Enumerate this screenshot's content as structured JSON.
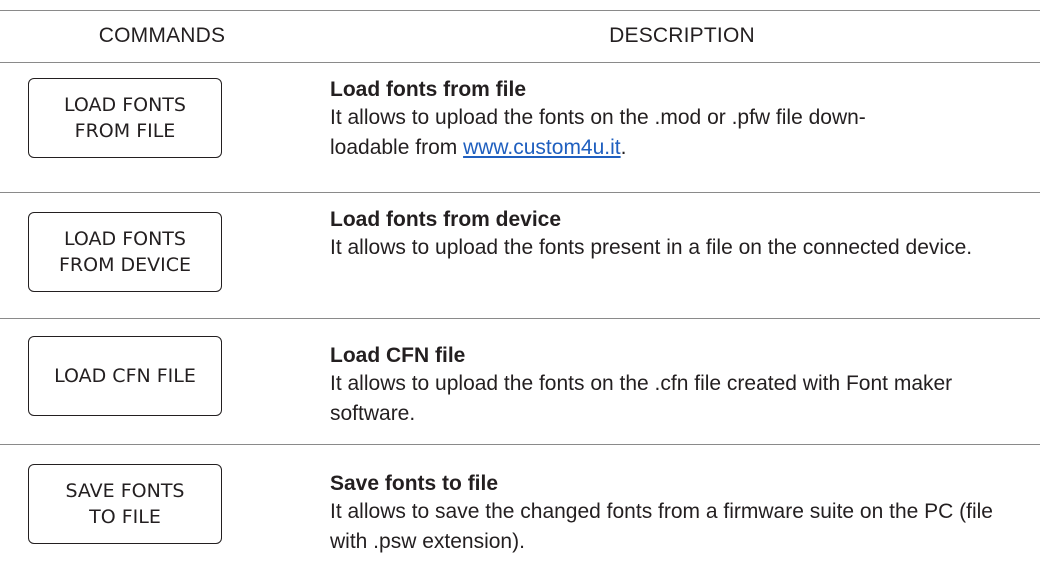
{
  "header": {
    "commands": "COMMANDS",
    "description": "DESCRIPTION"
  },
  "rows": [
    {
      "button": "LOAD FONTS\nFROM FILE",
      "title": "Load fonts from file",
      "text_line1": "It allows to upload the fonts on the .mod or .pfw file down-",
      "text_line2_before": "loadable from ",
      "link": "www.custom4u.it",
      "text_line2_after": "."
    },
    {
      "button": "LOAD FONTS\nFROM DEVICE",
      "title": "Load fonts from device",
      "text": "It allows to upload the fonts present in a file on the connected device."
    },
    {
      "button": "LOAD CFN FILE",
      "title": "Load CFN file",
      "text": "It allows to upload the fonts on the .cfn file created with Font maker software."
    },
    {
      "button": "SAVE FONTS\nTO FILE",
      "title": "Save fonts to file",
      "text": "It allows to save the changed fonts from a firmware suite on the PC (file with .psw extension)."
    }
  ],
  "colors": {
    "text": "#231f20",
    "rule": "#8a8a8a",
    "link": "#1f5fbf"
  }
}
